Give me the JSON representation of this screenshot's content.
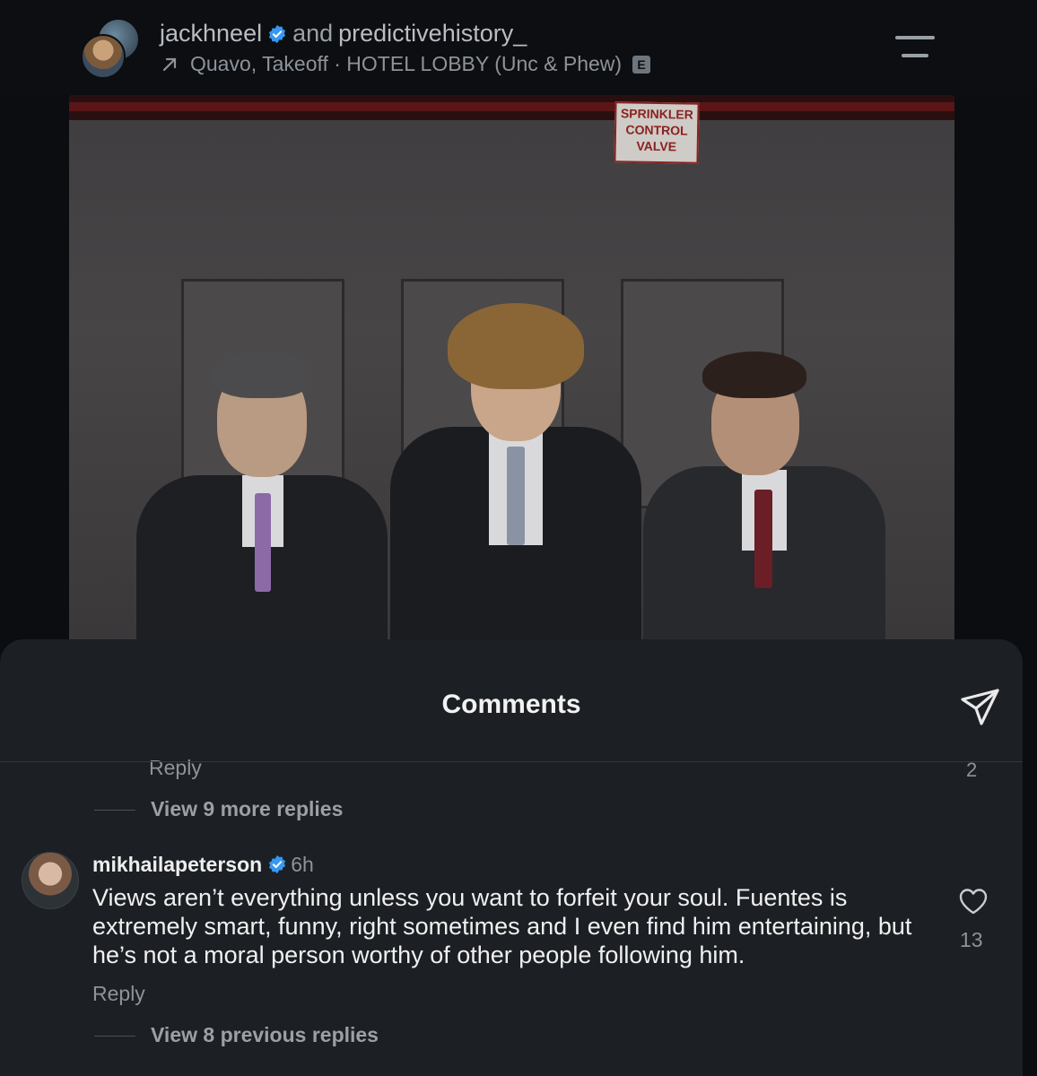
{
  "post": {
    "author": "jackhneel",
    "connector": "and",
    "collaborator": "predictivehistory_",
    "audio": "Quavo, Takeoff · HOTEL LOBBY (Unc & Phew)",
    "explicit_badge": "E",
    "photo_sign": [
      "SPRINKLER",
      "CONTROL",
      "VALVE"
    ]
  },
  "comments_sheet": {
    "title": "Comments",
    "previous_thread": {
      "reply_label": "Reply",
      "like_count": "2",
      "view_more": "View 9 more replies"
    },
    "comment": {
      "username": "mikhailapeterson",
      "time": "6h",
      "text": "Views aren’t everything unless you want to forfeit your soul. Fuentes is extremely smart, funny, right sometimes and I even find him entertaining, but he’s not a moral person worthy of other people following him.",
      "reply_label": "Reply",
      "like_count": "13",
      "view_previous": "View 8 previous replies"
    }
  },
  "colors": {
    "verified_blue": "#3897f0",
    "sheet_bg": "#1c1f23",
    "page_bg": "#0b0d10"
  },
  "icons": [
    "verified-icon",
    "audio-arrow-icon",
    "menu-icon",
    "share-icon",
    "heart-icon"
  ]
}
